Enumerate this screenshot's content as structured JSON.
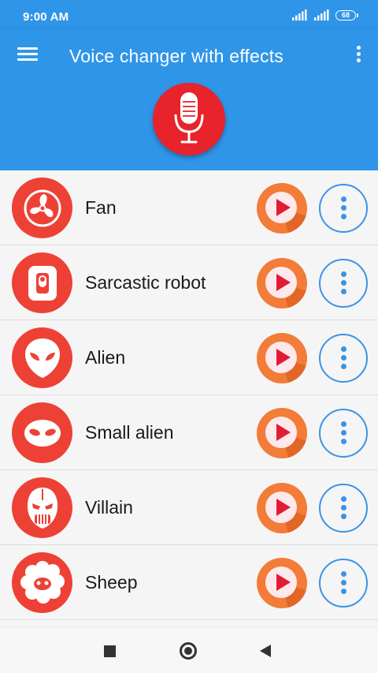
{
  "status_bar": {
    "time": "9:00 AM",
    "battery": "68",
    "icons": [
      "signal-icon",
      "signal-icon",
      "battery-icon"
    ]
  },
  "app_bar": {
    "title": "Voice changer with effects",
    "menu_icon": "menu-icon",
    "overflow_icon": "more-vertical-icon",
    "record_icon": "microphone-icon"
  },
  "colors": {
    "primary": "#2f95e8",
    "record": "#e7232c",
    "avatar": "#ee4135",
    "play": "#f27c38",
    "play_triangle": "#e21c35",
    "more_outline": "#3b93e6"
  },
  "effects": [
    {
      "label": "Fan",
      "icon": "fan-icon"
    },
    {
      "label": "Sarcastic robot",
      "icon": "robot-icon"
    },
    {
      "label": "Alien",
      "icon": "alien-icon"
    },
    {
      "label": "Small alien",
      "icon": "small-alien-icon"
    },
    {
      "label": "Villain",
      "icon": "villain-mask-icon"
    },
    {
      "label": "Sheep",
      "icon": "sheep-icon"
    }
  ],
  "nav_bar": {
    "icons": [
      "recents-icon",
      "home-icon",
      "back-icon"
    ]
  }
}
